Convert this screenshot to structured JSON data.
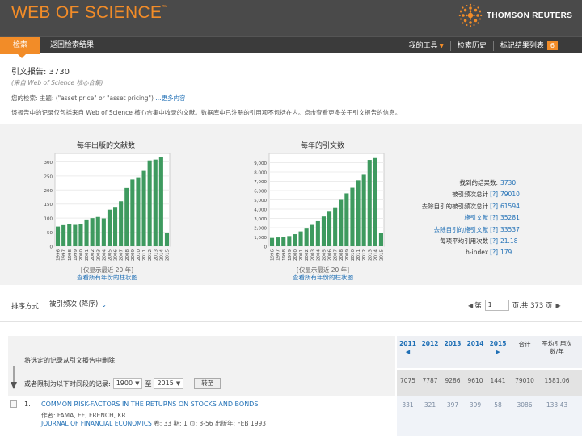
{
  "app": {
    "logo_text": "WEB OF SCIENCE",
    "logo_tm": "™",
    "publisher": "THOMSON REUTERS"
  },
  "nav": {
    "search_label": "检索",
    "back_label": "返回检索结果",
    "tools_label": "我的工具",
    "history_label": "检索历史",
    "marked_label": "标记结果列表",
    "marked_count": "6"
  },
  "report": {
    "title": "引文报告: 3730",
    "subtitle": "(来自 Web of Science 核心合集)",
    "query_prefix": "您的检索: 主题: (\"asset price\" or \"asset pricing\")",
    "query_more": "...更多内容",
    "info_line": "该报告中的记录仅包括来自 Web of Science 核心合集中收录的文献。数据库中已注册的引用项不包括在内。点击查看更多关于引文报告的信息。"
  },
  "charts": {
    "items_title": "每年出版的文献数",
    "citations_title": "每年的引文数",
    "items_link_note": "[仅显示最近 20 年]",
    "items_link": "查看所有年份的柱状图",
    "citations_link_note": "[仅显示最近 20 年]",
    "citations_link": "查看所有年份的柱状图"
  },
  "chart_data": [
    {
      "type": "bar",
      "title": "每年出版的文献数",
      "categories": [
        "1996",
        "1997",
        "1998",
        "1999",
        "2000",
        "2001",
        "2002",
        "2003",
        "2004",
        "2005",
        "2006",
        "2007",
        "2008",
        "2009",
        "2010",
        "2011",
        "2012",
        "2013",
        "2014",
        "2015"
      ],
      "values": [
        70,
        75,
        78,
        76,
        80,
        95,
        100,
        104,
        99,
        130,
        140,
        160,
        207,
        237,
        245,
        268,
        305,
        308,
        316,
        48
      ],
      "ylim": [
        0,
        330
      ],
      "yticks": [
        0,
        50,
        100,
        150,
        200,
        250,
        300
      ],
      "color": "#3e9a5f"
    },
    {
      "type": "bar",
      "title": "每年的引文数",
      "categories": [
        "1996",
        "1997",
        "1998",
        "1999",
        "2000",
        "2001",
        "2002",
        "2003",
        "2004",
        "2005",
        "2006",
        "2007",
        "2008",
        "2009",
        "2010",
        "2011",
        "2012",
        "2013",
        "2014",
        "2015"
      ],
      "values": [
        900,
        950,
        1000,
        1100,
        1300,
        1600,
        1900,
        2300,
        2700,
        3200,
        3800,
        4200,
        5000,
        5700,
        6300,
        7100,
        7700,
        9300,
        9500,
        1400
      ],
      "ylim": [
        0,
        10000
      ],
      "yticks": [
        0,
        1000,
        2000,
        3000,
        4000,
        5000,
        6000,
        7000,
        8000,
        9000
      ],
      "ytick_labels": [
        "0",
        "1,000",
        "2,000",
        "3,000",
        "4,000",
        "5,000",
        "6,000",
        "7,000",
        "8,000",
        "9,000"
      ],
      "color": "#3e9a5f"
    }
  ],
  "stats": [
    {
      "label": "找到的结果数:",
      "help": "",
      "value": "3730",
      "link": false
    },
    {
      "label": "被引频次总计",
      "help": "[?]",
      "value": "79010",
      "link": false
    },
    {
      "label": "去除自引的被引频次总计",
      "help": "[?]",
      "value": "61594",
      "link": false
    },
    {
      "label": "施引文献",
      "help": "[?]",
      "value": "35281",
      "link": true
    },
    {
      "label": "去除自引的施引文献",
      "help": "[?]",
      "value": "33537",
      "link": true
    },
    {
      "label": "每项平均引用次数",
      "help": "[?]",
      "value": "21.18",
      "link": false
    },
    {
      "label": "h-index",
      "help": "[?]",
      "value": "179",
      "link": false
    }
  ],
  "sort": {
    "label": "排序方式:",
    "value": "被引频次 (降序)"
  },
  "pager": {
    "page_prefix": "第",
    "page_value": "1",
    "page_suffix": "页,共 373 页"
  },
  "table": {
    "years": [
      "2011",
      "2012",
      "2013",
      "2014",
      "2015"
    ],
    "total_header": "合计",
    "avg_header": "平均引用次数/年",
    "note": "将选定的记录从引文报告中删除",
    "range_label": "或者限制为以下时间段的记录:",
    "range_from": "1900",
    "range_to_label": "至",
    "range_to": "2015",
    "go_label": "转至",
    "totals": [
      "7075",
      "7787",
      "9286",
      "9610",
      "1441",
      "79010",
      "1581.06"
    ]
  },
  "results": [
    {
      "num": "1.",
      "title": "COMMON RISK-FACTORS IN THE RETURNS ON STOCKS AND BONDS",
      "authors": "作者: FAMA, EF; FRENCH, KR",
      "journal": "JOURNAL OF FINANCIAL ECONOMICS",
      "meta": "卷: 33  期: 1  页: 3-56  出版年: FEB 1993",
      "values": [
        "331",
        "321",
        "397",
        "399",
        "58",
        "3086",
        "133.43"
      ]
    }
  ]
}
